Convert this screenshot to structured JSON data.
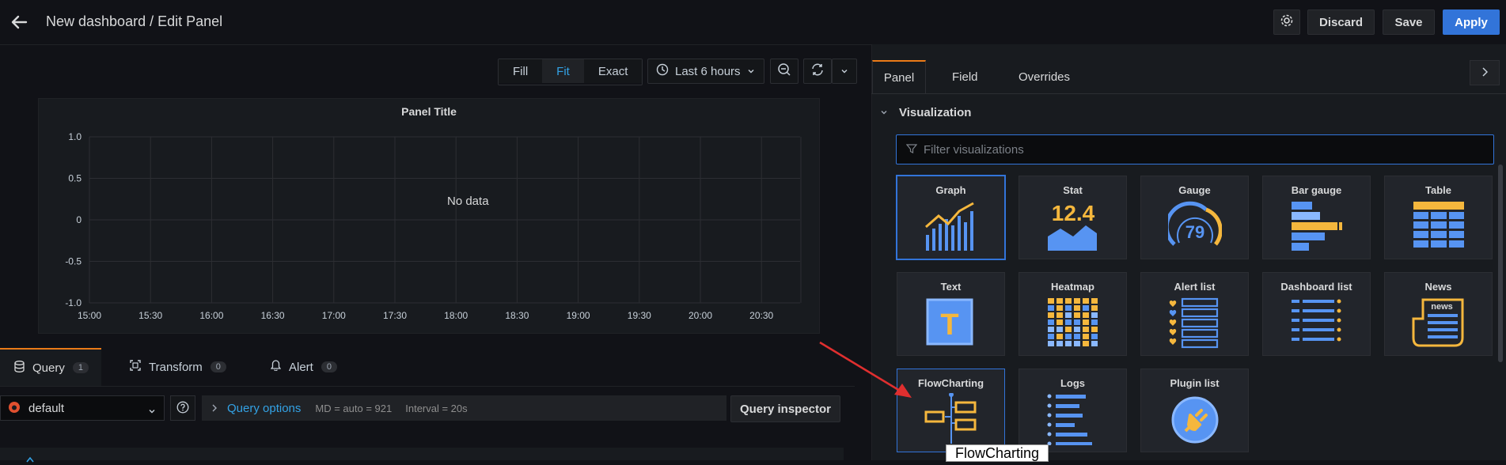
{
  "header": {
    "title": "New dashboard / Edit Panel",
    "discard_label": "Discard",
    "save_label": "Save",
    "apply_label": "Apply"
  },
  "toolbar": {
    "view_modes": [
      "Fill",
      "Fit",
      "Exact"
    ],
    "active_view_mode": "Fit",
    "time_range": "Last 6 hours"
  },
  "panel": {
    "title": "Panel Title",
    "no_data": "No data",
    "y_ticks": [
      "1.0",
      "0.5",
      "0",
      "-0.5",
      "-1.0"
    ],
    "x_ticks": [
      "15:00",
      "15:30",
      "16:00",
      "16:30",
      "17:00",
      "17:30",
      "18:00",
      "18:30",
      "19:00",
      "19:30",
      "20:00",
      "20:30"
    ]
  },
  "query_tabs": [
    {
      "label": "Query",
      "count": "1"
    },
    {
      "label": "Transform",
      "count": "0"
    },
    {
      "label": "Alert",
      "count": "0"
    }
  ],
  "query": {
    "datasource": "default",
    "options_label": "Query options",
    "md": "MD = auto = 921",
    "interval": "Interval = 20s",
    "inspector_label": "Query inspector"
  },
  "right_tabs": [
    "Panel",
    "Field",
    "Overrides"
  ],
  "visualization": {
    "header": "Visualization",
    "filter_placeholder": "Filter visualizations",
    "cards": [
      "Graph",
      "Stat",
      "Gauge",
      "Bar gauge",
      "Table",
      "Text",
      "Heatmap",
      "Alert list",
      "Dashboard list",
      "News",
      "FlowCharting",
      "Logs",
      "Plugin list"
    ],
    "selected": "Graph",
    "stat_value": "12.4",
    "gauge_value": "79",
    "text_glyph": "T",
    "news_badge": "news"
  },
  "tooltip": "FlowCharting",
  "colors": {
    "accent_blue": "#3274d9",
    "accent_orange": "#eb7b18",
    "viz_yellow": "#f5b73d",
    "viz_blue": "#5794f2",
    "annotation_red": "#e02f2f"
  }
}
